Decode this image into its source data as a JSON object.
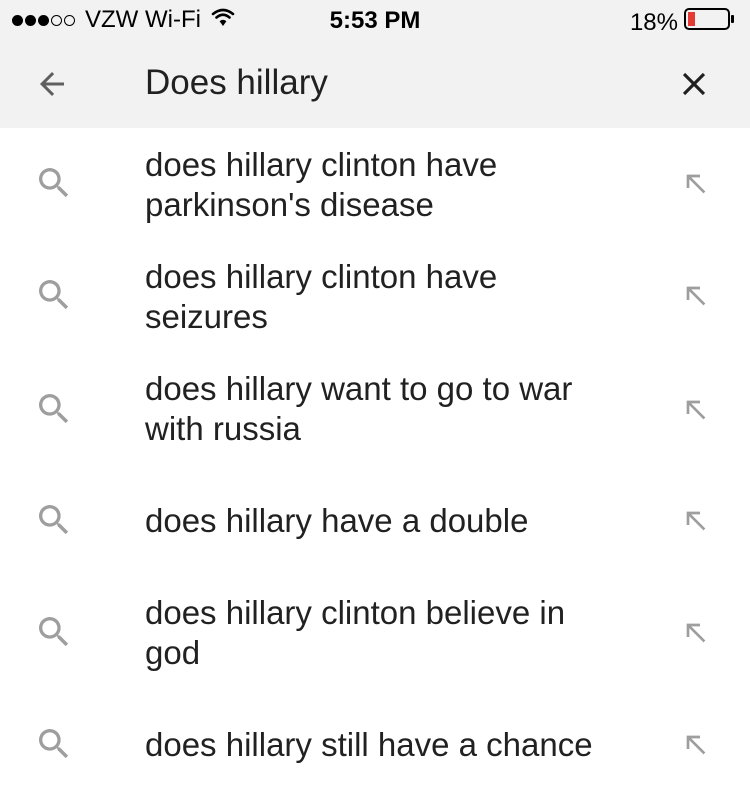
{
  "status_bar": {
    "carrier": "VZW Wi-Fi",
    "time": "5:53 PM",
    "battery": "18%",
    "signal_bars_filled": 3,
    "signal_bars_total": 5,
    "battery_level": 0.18,
    "battery_color": "#e53935"
  },
  "search": {
    "query": "Does hillary",
    "back_icon": "arrow-left-icon",
    "clear_icon": "close-icon"
  },
  "suggestions": [
    {
      "line1": "does hillary clinton have",
      "line2": "parkinson's disease"
    },
    {
      "line1": "does hillary clinton have",
      "line2": "seizures"
    },
    {
      "line1": "does hillary want to go to war",
      "line2": "with russia"
    },
    {
      "line1": "does hillary have a double",
      "line2": ""
    },
    {
      "line1": "does hillary clinton believe in",
      "line2": "god"
    },
    {
      "line1": "does hillary still have a chance",
      "line2": ""
    }
  ],
  "colors": {
    "header_bg": "#f2f2f2",
    "icon_gray": "#9e9e9e",
    "text": "#212121"
  }
}
